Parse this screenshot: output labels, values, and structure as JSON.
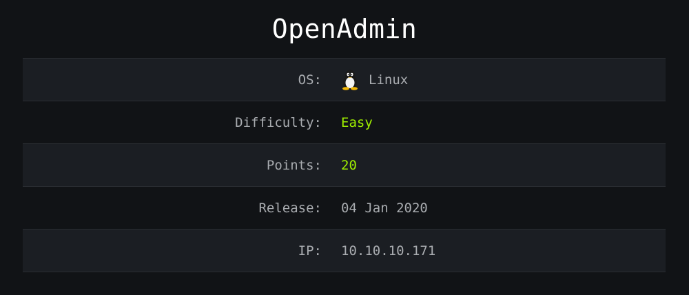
{
  "title": "OpenAdmin",
  "rows": [
    {
      "label": "OS:",
      "value": "Linux",
      "icon": "linux-tux-icon"
    },
    {
      "label": "Difficulty:",
      "value": "Easy",
      "value_color": "#9fef00"
    },
    {
      "label": "Points:",
      "value": "20",
      "value_color": "#9fef00"
    },
    {
      "label": "Release:",
      "value": "04 Jan 2020"
    },
    {
      "label": "IP:",
      "value": "10.10.10.171"
    }
  ],
  "colors": {
    "background": "#111316",
    "row_shaded": "#1b1e23",
    "text": "#a9acb0",
    "accent_green": "#9fef00"
  }
}
